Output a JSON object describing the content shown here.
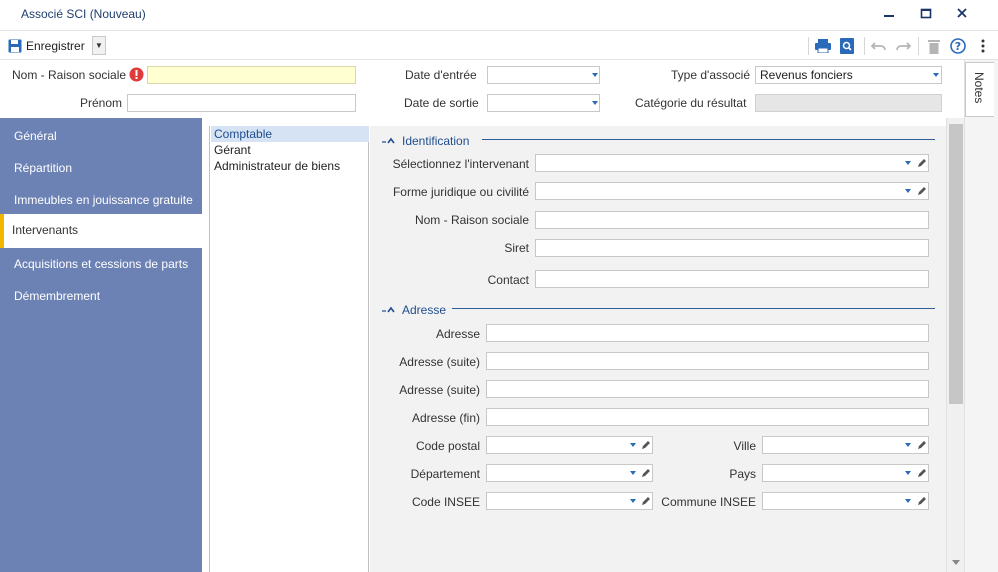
{
  "window": {
    "title": "Associé SCI (Nouveau)"
  },
  "toolbar": {
    "save_label": "Enregistrer"
  },
  "header": {
    "nom_label": "Nom - Raison sociale",
    "nom_value": "",
    "prenom_label": "Prénom",
    "date_entree_label": "Date d'entrée",
    "date_sortie_label": "Date de sortie",
    "type_associe_label": "Type d'associé",
    "type_associe_value": "Revenus fonciers",
    "categorie_label": "Catégorie du résultat"
  },
  "notes_tab": "Notes",
  "leftnav": {
    "items": [
      {
        "label": "Général"
      },
      {
        "label": "Répartition"
      },
      {
        "label": "Immeubles en jouissance gratuite"
      },
      {
        "label": "Intervenants"
      },
      {
        "label": "Acquisitions et cessions de parts"
      },
      {
        "label": "Démembrement"
      }
    ]
  },
  "midlist": {
    "items": [
      {
        "label": "Comptable"
      },
      {
        "label": "Gérant"
      },
      {
        "label": "Administrateur de biens"
      }
    ]
  },
  "identification": {
    "title": "Identification",
    "intervenant_label": "Sélectionnez l'intervenant",
    "forme_label": "Forme juridique ou civilité",
    "nom_label": "Nom - Raison sociale",
    "siret_label": "Siret",
    "contact_label": "Contact"
  },
  "adresse": {
    "title": "Adresse",
    "adresse_label": "Adresse",
    "adresse_suite1_label": "Adresse (suite)",
    "adresse_suite2_label": "Adresse (suite)",
    "adresse_fin_label": "Adresse (fin)",
    "code_postal_label": "Code postal",
    "ville_label": "Ville",
    "departement_label": "Département",
    "pays_label": "Pays",
    "code_insee_label": "Code INSEE",
    "commune_insee_label": "Commune INSEE"
  },
  "colors": {
    "nav_bg": "#6c82b4",
    "accent": "#f2b600",
    "link_blue": "#1f4e8c",
    "required": "#e03b3b"
  }
}
